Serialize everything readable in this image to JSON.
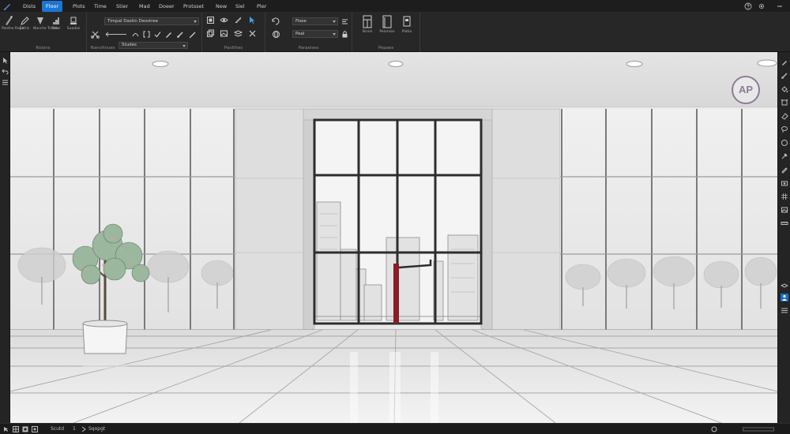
{
  "tabs": [
    {
      "label": "Dists"
    },
    {
      "label": "Floor",
      "active": true
    },
    {
      "label": "Plots"
    },
    {
      "label": "Time"
    },
    {
      "label": "Stier"
    },
    {
      "label": "Mad"
    },
    {
      "label": "Doeer"
    },
    {
      "label": "Protsset"
    },
    {
      "label": "New"
    },
    {
      "label": "Siel"
    },
    {
      "label": "Pler"
    }
  ],
  "ribbon": {
    "group1": {
      "label": "Roions",
      "buttons": [
        "Panthe Rapir",
        "Eatris",
        "Nocche Trastls",
        "Riser",
        "Suodos"
      ]
    },
    "group2": {
      "label": "Nanoltnues",
      "dropdown_value": "Timpal Dastin Desstree",
      "sub_dropdown": "Studes"
    },
    "group3": {
      "label": "Paolthes"
    },
    "group4": {
      "label": "Paraelses",
      "dropdown1": "Fisee",
      "dropdown2": "Peal"
    },
    "group5": {
      "label": "Pepaes",
      "buttons": [
        "Stnim",
        "Peomian",
        "Piatia"
      ]
    }
  },
  "viewport": {
    "watermark": "AP",
    "accent_color": "#8a1c24"
  },
  "statusbar": {
    "text1": "Scutd",
    "text2": "1",
    "text3": "Sqopgt"
  }
}
